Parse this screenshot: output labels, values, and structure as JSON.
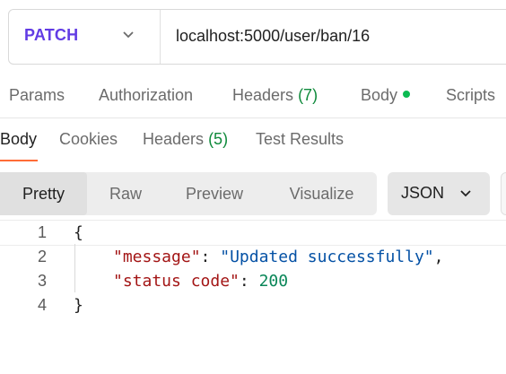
{
  "request": {
    "method": "PATCH",
    "url": "localhost:5000/user/ban/16",
    "method_color": "#623ce4"
  },
  "request_tabs": {
    "params": "Params",
    "authorization": "Authorization",
    "headers_label": "Headers",
    "headers_count": "(7)",
    "body": "Body",
    "scripts": "Scripts"
  },
  "response_tabs": {
    "body": "Body",
    "cookies": "Cookies",
    "headers_label": "Headers",
    "headers_count": "(5)",
    "test_results": "Test Results",
    "active": "Body"
  },
  "format_toolbar": {
    "pretty": "Pretty",
    "raw": "Raw",
    "preview": "Preview",
    "visualize": "Visualize",
    "selected_format": "JSON",
    "active": "Pretty"
  },
  "response_body": {
    "line_numbers": [
      "1",
      "2",
      "3",
      "4"
    ],
    "open_brace": "{",
    "close_brace": "}",
    "entries": [
      {
        "key": "\"message\"",
        "value": "\"Updated successfully\"",
        "trailing": ","
      },
      {
        "key": "\"status code\"",
        "value": "200",
        "trailing": ""
      }
    ]
  },
  "colors": {
    "accent_underline": "#ff6c37",
    "green_count": "#0f8a3b",
    "green_dot": "#0cbb52",
    "json_key": "#a31515",
    "json_string": "#0451a5",
    "json_number": "#098658"
  }
}
